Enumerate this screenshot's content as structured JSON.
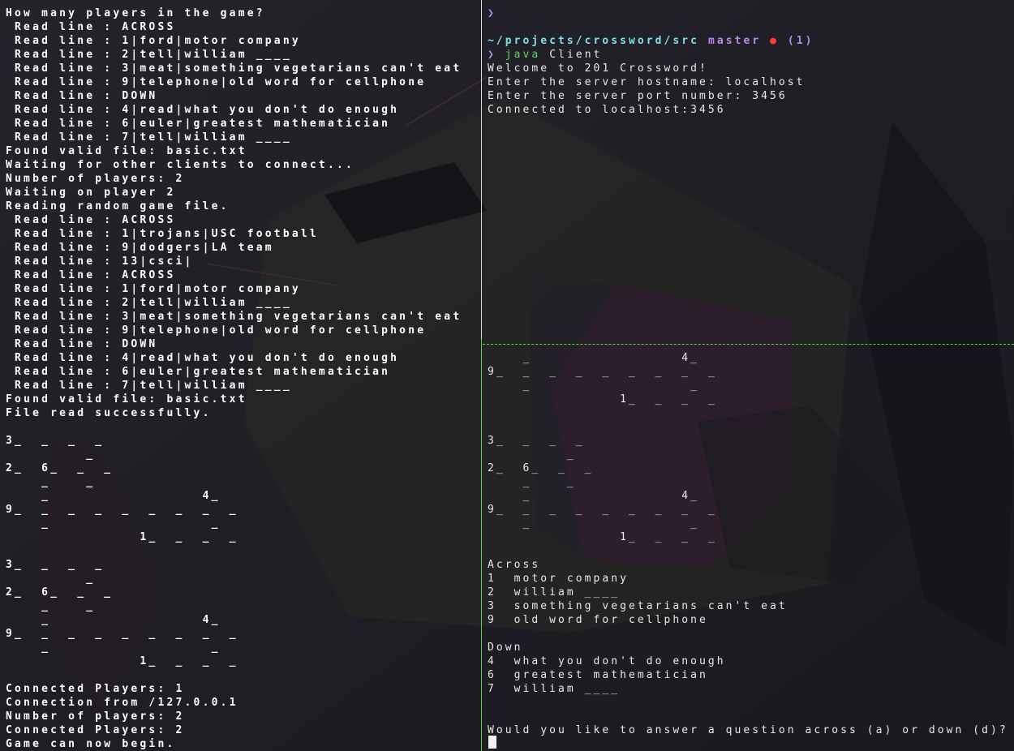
{
  "left_pane": {
    "lines": [
      "How many players in the game?",
      " Read line : ACROSS",
      " Read line : 1|ford|motor company",
      " Read line : 2|tell|william ____",
      " Read line : 3|meat|something vegetarians can't eat",
      " Read line : 9|telephone|old word for cellphone",
      " Read line : DOWN",
      " Read line : 4|read|what you don't do enough",
      " Read line : 6|euler|greatest mathematician",
      " Read line : 7|tell|william ____",
      "Found valid file: basic.txt",
      "Waiting for other clients to connect...",
      "Number of players: 2",
      "Waiting on player 2",
      "Reading random game file.",
      " Read line : ACROSS",
      " Read line : 1|trojans|USC football",
      " Read line : 9|dodgers|LA team",
      " Read line : 13|csci|",
      " Read line : ACROSS",
      " Read line : 1|ford|motor company",
      " Read line : 2|tell|william ____",
      " Read line : 3|meat|something vegetarians can't eat",
      " Read line : 9|telephone|old word for cellphone",
      " Read line : DOWN",
      " Read line : 4|read|what you don't do enough",
      " Read line : 6|euler|greatest mathematician",
      " Read line : 7|tell|william ____",
      "Found valid file: basic.txt",
      "File read successfully.",
      "",
      "3_  _  _  _",
      "         _",
      "2_  6_  _  _",
      "    _    _",
      "    _                 4_",
      "9_  _  _  _  _  _  _  _  _",
      "    _                  _",
      "               1_  _  _  _",
      "",
      "3_  _  _  _",
      "         _",
      "2_  6_  _  _",
      "    _    _",
      "    _                 4_",
      "9_  _  _  _  _  _  _  _  _",
      "    _                  _",
      "               1_  _  _  _",
      "",
      "Connected Players: 1",
      "Connection from /127.0.0.1",
      "Number of players: 2",
      "Connected Players: 2",
      "Game can now begin."
    ]
  },
  "right_pane": {
    "prompt_symbol": "❯",
    "cwd": "~/projects/crossword/src",
    "git_branch": "master",
    "git_dirty_marker": "●",
    "jobs_count": "(1)",
    "command_java": "java",
    "command_arg": "Client",
    "output_lines": [
      "Welcome to 201 Crossword!",
      "Enter the server hostname: localhost",
      "Enter the server port number: 3456",
      "Connected to localhost:3456"
    ],
    "board_lines": [
      "    _                 4_",
      "9_  _  _  _  _  _  _  _  _",
      "    _                  _",
      "               1_  _  _  _",
      "",
      "",
      "3_  _  _  _",
      "         _",
      "2_  6_  _  _",
      "    _    _",
      "    _                 4_",
      "9_  _  _  _  _  _  _  _  _",
      "    _                  _",
      "               1_  _  _  _",
      "",
      "Across",
      "1  motor company",
      "2  william ____",
      "3  something vegetarians can't eat",
      "9  old word for cellphone",
      "",
      "Down",
      "4  what you don't do enough",
      "6  greatest mathematician",
      "7  william ____",
      "",
      "",
      "Would you like to answer a question across (a) or down (d)?"
    ]
  },
  "colors": {
    "background": "#1c1b20",
    "left_text": "#ffffff",
    "right_text": "#e8e8e8",
    "prompt": "#b58cf0",
    "command": "#5fd35f",
    "path": "#7fe0e6",
    "dirty": "#ff3b3b",
    "tmux_active_border": "#4fd34f"
  }
}
